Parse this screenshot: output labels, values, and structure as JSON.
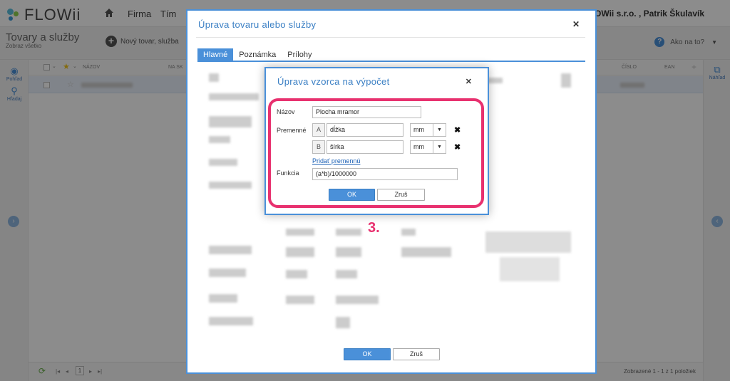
{
  "app": {
    "logo_text": "FLOWii",
    "nav": [
      "Firma",
      "Tím"
    ],
    "company_user": "OK FLOWii s.r.o. , Patrik Škulavík",
    "page_title": "Tovary a služby",
    "page_subtitle": "Zobraz všetko",
    "new_item_label": "Nový tovar, služba",
    "help_label": "Ako na to?",
    "left_tools": [
      {
        "label": "Pohľad",
        "icon": "eye-icon"
      },
      {
        "label": "Hľadaj",
        "icon": "search-icon"
      }
    ],
    "right_tool": {
      "label": "Náhľad",
      "icon": "external-link-icon"
    },
    "columns": {
      "name": "NÁZOV",
      "stock": "NA SK",
      "number": "ČÍSLO",
      "ean": "EAN"
    },
    "pager_page": "1",
    "count_text": "Zobrazené 1 - 1 z 1 položiek"
  },
  "outer_modal": {
    "title": "Úprava tovaru alebo služby",
    "tabs": [
      {
        "label": "Hlavné",
        "active": true
      },
      {
        "label": "Poznámka",
        "active": false
      },
      {
        "label": "Prílohy",
        "active": false
      }
    ],
    "ok_label": "OK",
    "cancel_label": "Zruš"
  },
  "inner_modal": {
    "title": "Úprava vzorca na výpočet",
    "name_label": "Názov",
    "name_value": "Plocha mramor",
    "variables_label": "Premenné",
    "variables": [
      {
        "letter": "A",
        "name": "dĺžka",
        "unit": "mm"
      },
      {
        "letter": "B",
        "name": "šírka",
        "unit": "mm"
      }
    ],
    "add_variable_link": "Pridať premennú",
    "function_label": "Funkcia",
    "function_value": "(a*b)/1000000",
    "ok_label": "OK",
    "cancel_label": "Zruš"
  },
  "annotation": {
    "step": "3.",
    "color": "#e8316f"
  },
  "colors": {
    "accent": "#4a90d9",
    "highlight": "#e8316f"
  }
}
